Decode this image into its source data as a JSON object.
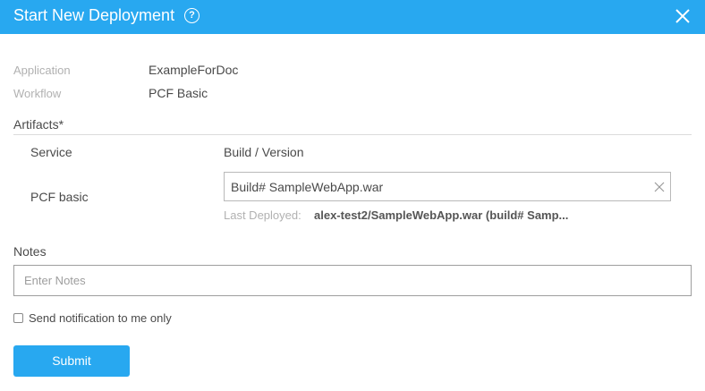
{
  "header": {
    "title": "Start New Deployment",
    "help_glyph": "?",
    "help_icon": "help-circle-icon",
    "close_icon": "close-icon"
  },
  "details": {
    "application_label": "Application",
    "application_value": "ExampleForDoc",
    "workflow_label": "Workflow",
    "workflow_value": "PCF Basic"
  },
  "artifacts": {
    "title": "Artifacts*",
    "service_header": "Service",
    "build_header": "Build / Version",
    "rows": [
      {
        "service": "PCF basic",
        "build_value": "Build# SampleWebApp.war",
        "last_deployed_label": "Last Deployed:",
        "last_deployed_value": "alex-test2/SampleWebApp.war (build# Samp..."
      }
    ]
  },
  "notes": {
    "label": "Notes",
    "placeholder": "Enter Notes",
    "value": ""
  },
  "notify": {
    "label": "Send notification to me only",
    "checked": false
  },
  "submit_label": "Submit",
  "colors": {
    "accent": "#28a8f0",
    "muted_text": "#b1b1b1",
    "text": "#4a4a4a"
  }
}
